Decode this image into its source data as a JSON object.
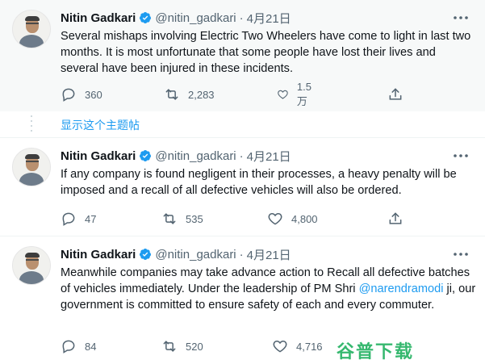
{
  "tweets": [
    {
      "name": "Nitin Gadkari",
      "handle": "@nitin_gadkari",
      "separator": "·",
      "date": "4月21日",
      "text": "Several mishaps involving Electric Two Wheelers have come to light in last two months. It is most unfortunate that some people have lost their lives and several have been injured in these incidents.",
      "replies": "360",
      "retweets": "2,283",
      "likes": "1.5万"
    },
    {
      "name": "Nitin Gadkari",
      "handle": "@nitin_gadkari",
      "separator": "·",
      "date": "4月21日",
      "text": "If any company is found negligent in their processes, a heavy penalty will be imposed and a recall of all defective vehicles will also be ordered.",
      "replies": "47",
      "retweets": "535",
      "likes": "4,800"
    },
    {
      "name": "Nitin Gadkari",
      "handle": "@nitin_gadkari",
      "separator": "·",
      "date": "4月21日",
      "text_before": "Meanwhile companies may take advance action to Recall all defective batches of vehicles immediately. Under the leadership of PM Shri ",
      "mention": "@narendramodi",
      "text_after": " ji, our government is committed to ensure safety of each and every commuter.",
      "replies": "84",
      "retweets": "520",
      "likes": "4,716"
    }
  ],
  "thread_link": "显示这个主题帖",
  "watermark": "谷普下载",
  "icons": {
    "more": "more-horizontal-icon",
    "verified": "verified-badge-icon",
    "reply": "reply-icon",
    "retweet": "retweet-icon",
    "like": "heart-icon",
    "share": "share-icon"
  },
  "colors": {
    "accent": "#1d9bf0",
    "secondary_text": "#536471",
    "watermark": "#36b86f"
  }
}
